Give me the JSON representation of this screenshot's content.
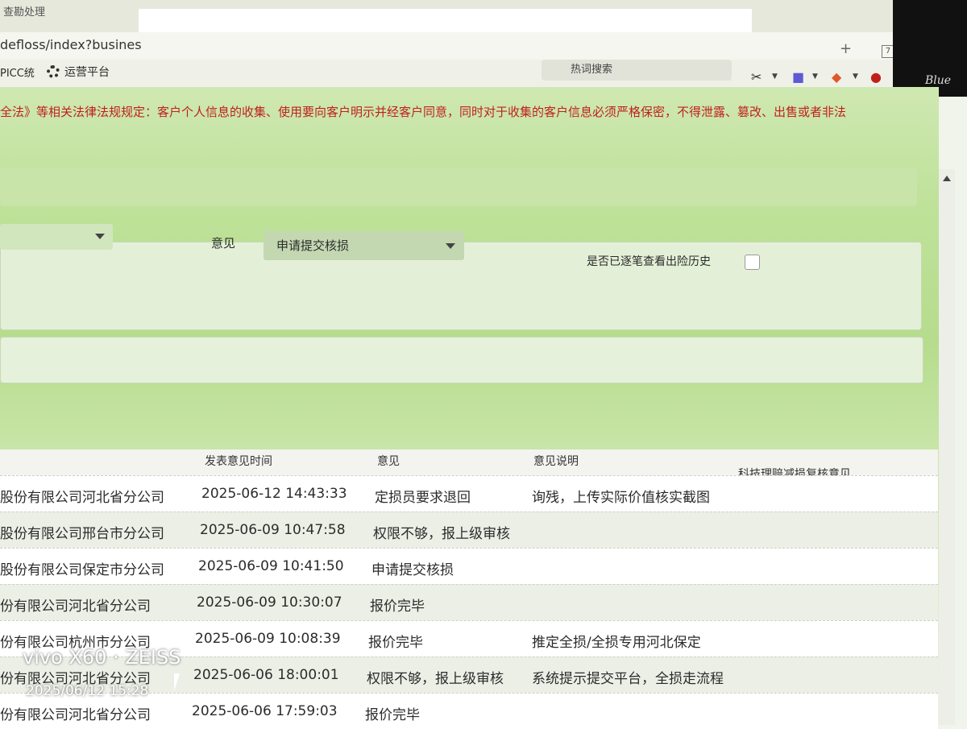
{
  "browser": {
    "tab_title": "查勘处理",
    "url": "defloss/index?busines",
    "bookmarks": {
      "picc": "PICC统",
      "ops": "运营平台"
    },
    "search_partial": "热词搜索",
    "camera_brand": "Blue"
  },
  "notice": "全法》等相关法律法规规定：客户个人信息的收集、使用要向客户明示并经客户同意，同时对于收集的客户信息必须严格保密，不得泄露、篡改、出售或者非法",
  "form": {
    "opinion_label": "意见",
    "opinion_value": "申请提交核损",
    "history_label": "是否已逐笔查看出险历史"
  },
  "table": {
    "headers": {
      "time": "发表意见时间",
      "opinion": "意见",
      "desc": "意见说明",
      "extra": "科技理赔减损复核意见"
    },
    "rows": [
      {
        "org": "股份有限公司河北省分公司",
        "time": "2025-06-12 14:43:33",
        "opinion": "定损员要求退回",
        "desc": "询残，上传实际价值核实截图"
      },
      {
        "org": "股份有限公司邢台市分公司",
        "time": "2025-06-09 10:47:58",
        "opinion": "权限不够，报上级审核",
        "desc": ""
      },
      {
        "org": "股份有限公司保定市分公司",
        "time": "2025-06-09 10:41:50",
        "opinion": "申请提交核损",
        "desc": ""
      },
      {
        "org": "份有限公司河北省分公司",
        "time": "2025-06-09 10:30:07",
        "opinion": "报价完毕",
        "desc": ""
      },
      {
        "org": "份有限公司杭州市分公司",
        "time": "2025-06-09 10:08:39",
        "opinion": "报价完毕",
        "desc": "推定全损/全损专用河北保定"
      },
      {
        "org": "份有限公司河北省分公司",
        "time": "2025-06-06 18:00:01",
        "opinion": "权限不够，报上级审核",
        "desc": "系统提示提交平台，全损走流程"
      },
      {
        "org": "份有限公司河北省分公司",
        "time": "2025-06-06 17:59:03",
        "opinion": "报价完毕",
        "desc": ""
      }
    ]
  },
  "watermark": {
    "line1": "vivo X60 · ZEISS",
    "line2": "2025/06/12 15:28"
  }
}
